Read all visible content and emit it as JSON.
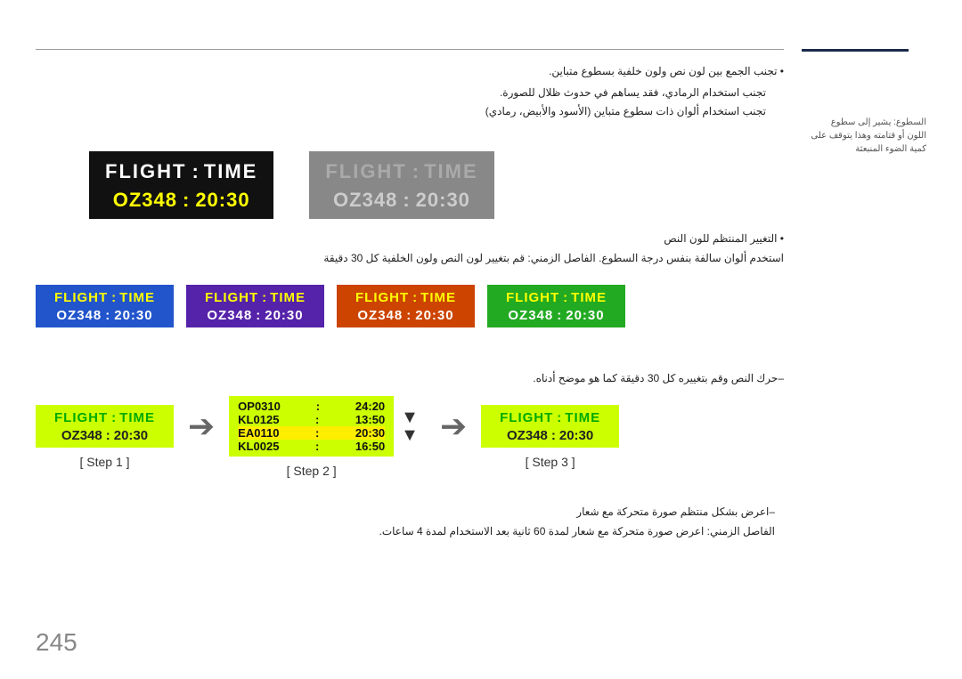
{
  "page": {
    "number": "245"
  },
  "top_line": {},
  "sidebar_note": "السطوع: يشير إلى سطوع اللون أو قتامته وهذا يتوقف على كمية الضوء المنبعثة",
  "arabic_top": {
    "bullet1": "تجنب الجمع بين لون نص ولون خلفية بسطوع متباين.",
    "dash1": "تجنب استخدام الرمادي، فقد يساهم في حدوث ظلال للصورة.",
    "dash2": "تجنب استخدام ألوان ذات سطوع متباين (الأسود والأبيض، رمادي)"
  },
  "panel1": {
    "bg": "black",
    "title1": "FLIGHT",
    "colon": ":",
    "title2": "TIME",
    "data1": "OZ348",
    "data_colon": ":",
    "data2": "20:30"
  },
  "panel2": {
    "bg": "gray",
    "title1": "FLIGHT",
    "colon": ":",
    "title2": "TIME",
    "data1": "OZ348",
    "data_colon": ":",
    "data2": "20:30"
  },
  "arabic_mid": {
    "bullet": "التغيير المنتظم للون النص",
    "dash1": "استخدم ألوان سالفة بنفس درجة السطوع.",
    "dash2": "الفاصل الزمني: قم بتغيير لون النص ولون الخلفية كل 30 دقيقة"
  },
  "variants": [
    {
      "bg_class": "vpanel-blue",
      "title1": "FLIGHT",
      "colon": ":",
      "title2": "TIME",
      "data1": "OZ348",
      "dc": ":",
      "data2": "20:30"
    },
    {
      "bg_class": "vpanel-purple",
      "title1": "FLIGHT",
      "colon": ":",
      "title2": "TIME",
      "data1": "OZ348",
      "dc": ":",
      "data2": "20:30"
    },
    {
      "bg_class": "vpanel-orange",
      "title1": "FLIGHT",
      "colon": ":",
      "title2": "TIME",
      "data1": "OZ348",
      "dc": ":",
      "data2": "20:30"
    },
    {
      "bg_class": "vpanel-green",
      "title1": "FLIGHT",
      "colon": ":",
      "title2": "TIME",
      "data1": "OZ348",
      "dc": ":",
      "data2": "20:30"
    }
  ],
  "scroll_note": "–حرك النص وقم بتغييره كل 30 دقيقة كما هو موضح أدناه.",
  "steps": {
    "step1": {
      "label": "[ Step 1 ]",
      "title1": "FLIGHT",
      "colon": ":",
      "title2": "TIME",
      "data1": "OZ348",
      "dc": ":",
      "data2": "20:30"
    },
    "step2": {
      "label": "[ Step 2 ]",
      "rows": [
        {
          "flight": "OP0310",
          "colon": ":",
          "time": "24:20",
          "highlight": false
        },
        {
          "flight": "KL0125",
          "colon": ":",
          "time": "13:50",
          "highlight": false
        },
        {
          "flight": "EA0110",
          "colon": ":",
          "time": "20:30",
          "highlight": true
        },
        {
          "flight": "KL0025",
          "colon": ":",
          "time": "16:50",
          "highlight": false
        }
      ]
    },
    "step3": {
      "label": "[ Step 3 ]",
      "title1": "FLIGHT",
      "colon": ":",
      "title2": "TIME",
      "data1": "OZ348",
      "dc": ":",
      "data2": "20:30"
    }
  },
  "arabic_bottom": {
    "dash1": "–اعرض بشكل منتظم صورة متحركة مع شعار",
    "dash2": "الفاصل الزمني: اعرض صورة متحركة مع شعار لمدة 60 ثانية بعد الاستخدام لمدة 4 ساعات."
  }
}
